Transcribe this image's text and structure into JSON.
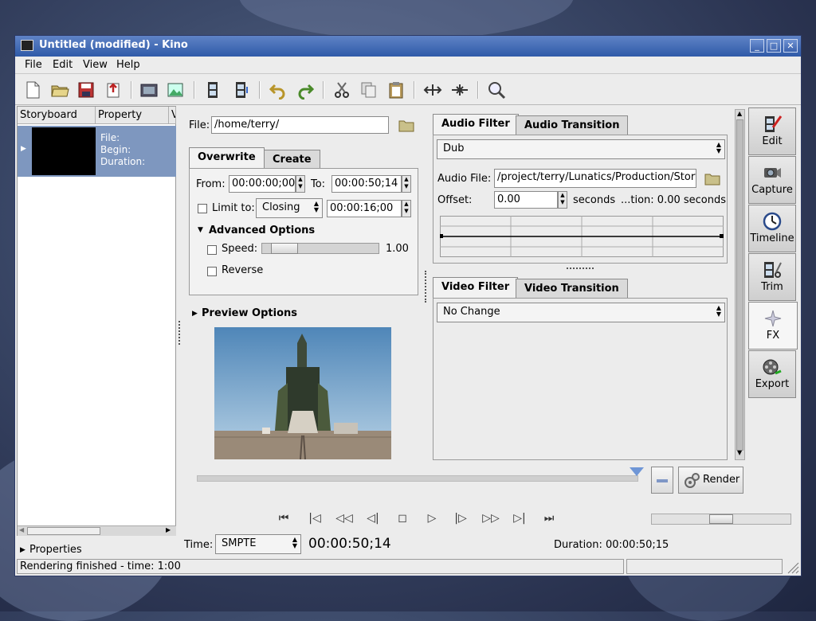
{
  "window": {
    "title": "Untitled (modified) - Kino"
  },
  "menu": [
    "File",
    "Edit",
    "View",
    "Help"
  ],
  "toolbar_icons": [
    "new-icon",
    "open-icon",
    "save-icon",
    "export-icon",
    "save-frame-icon",
    "import-image-icon",
    "insert-before-icon",
    "insert-after-icon",
    "undo-icon",
    "redo-icon",
    "cut-icon",
    "copy-icon",
    "paste-icon",
    "split-icon",
    "join-icon",
    "zoom-icon"
  ],
  "storyboard": {
    "headers": [
      "Storyboard",
      "Property",
      "V"
    ],
    "row": {
      "file": "File:",
      "begin": "Begin:",
      "duration": "Duration:"
    },
    "properties_label": "Properties"
  },
  "fx": {
    "file_label": "File:",
    "file_value": "/home/terry/",
    "tabs": [
      "Overwrite",
      "Create"
    ],
    "from_label": "From:",
    "from_value": "00:00:00;00",
    "to_label": "To:",
    "to_value": "00:00:50;14",
    "limit_label": "Limit to:",
    "limit_option": "Closing",
    "limit_value": "00:00:16;00",
    "advanced_label": "Advanced Options",
    "speed_label": "Speed:",
    "speed_value": "1.00",
    "speed_fraction": 0.1,
    "reverse_label": "Reverse",
    "preview_label": "Preview Options"
  },
  "audio": {
    "tabs": [
      "Audio Filter",
      "Audio Transition"
    ],
    "filter": "Dub",
    "file_label": "Audio File:",
    "file_value": "/project/terry/Lunatics/Production/Storyb",
    "offset_label": "Offset:",
    "offset_value": "0.00",
    "offset_unit": "seconds",
    "duration_text": "...tion: 0.00 seconds"
  },
  "video": {
    "tabs": [
      "Video Filter",
      "Video Transition"
    ],
    "filter": "No Change"
  },
  "render_label": "Render",
  "sidetabs": [
    "Edit",
    "Capture",
    "Timeline",
    "Trim",
    "FX",
    "Export"
  ],
  "time": {
    "label": "Time:",
    "format": "SMPTE",
    "value": "00:00:50;14",
    "duration": "Duration: 00:00:50;15"
  },
  "status": "Rendering finished - time: 1:00"
}
